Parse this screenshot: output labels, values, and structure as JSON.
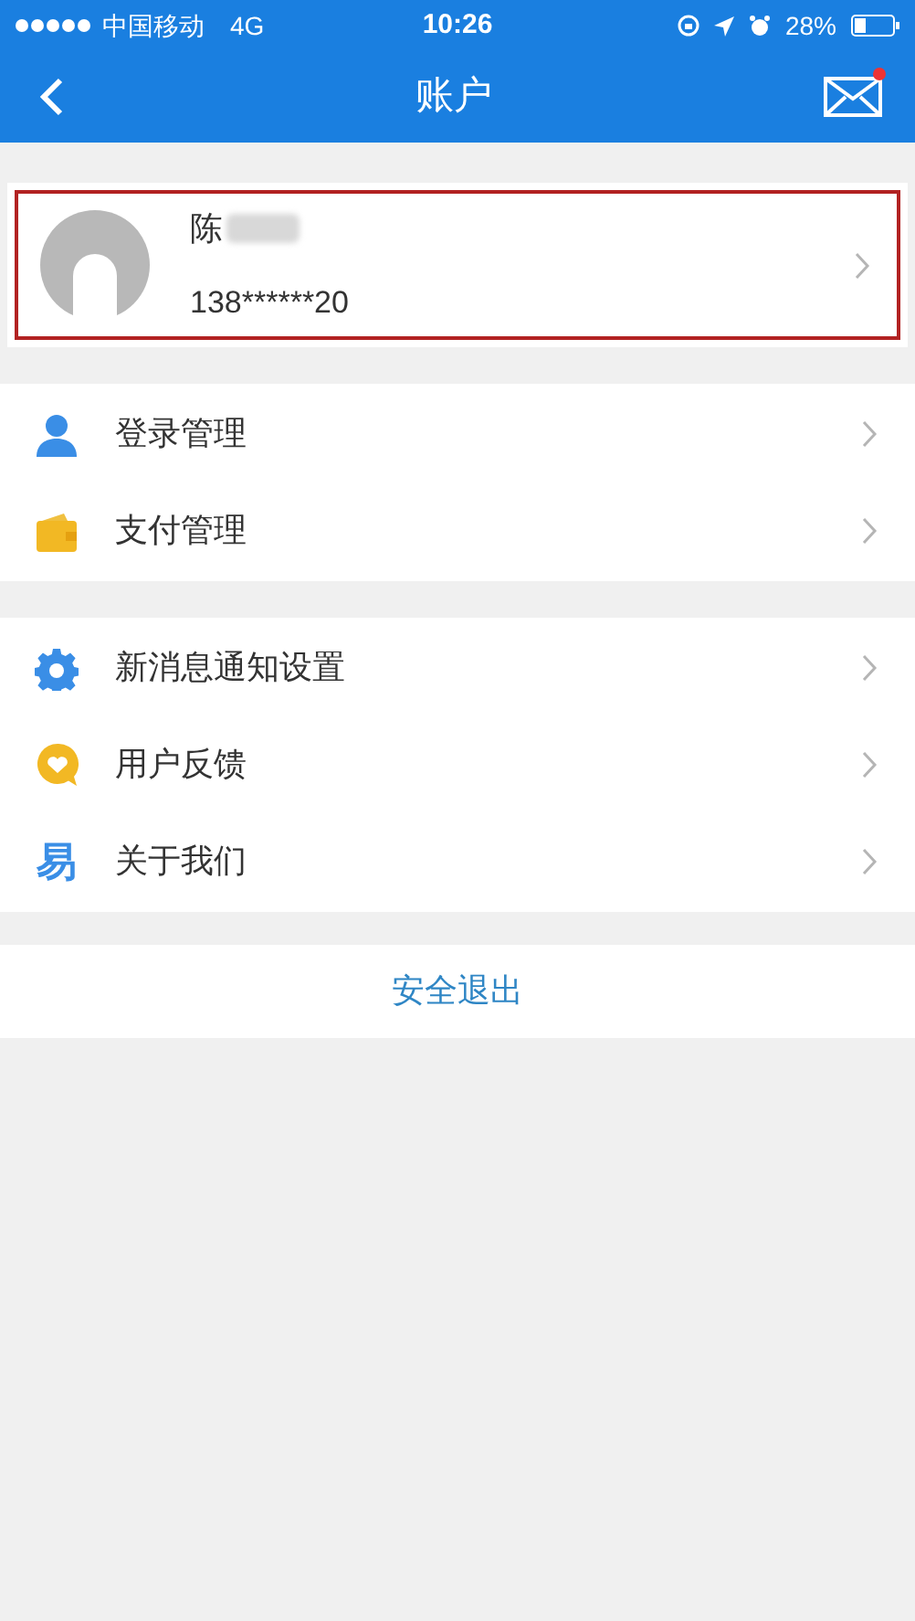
{
  "status_bar": {
    "carrier": "中国移动",
    "network": "4G",
    "time": "10:26",
    "battery": "28%"
  },
  "nav": {
    "title": "账户",
    "mail_unread": true
  },
  "profile": {
    "name": "陈",
    "name_redacted": true,
    "phone": "138******20",
    "highlighted": true
  },
  "groups": [
    {
      "items": [
        {
          "kind": "person",
          "label": "登录管理"
        },
        {
          "kind": "wallet",
          "label": "支付管理"
        }
      ]
    },
    {
      "items": [
        {
          "kind": "gear",
          "label": "新消息通知设置"
        },
        {
          "kind": "heart",
          "label": "用户反馈"
        },
        {
          "kind": "glyph",
          "glyph": "易",
          "label": "关于我们"
        }
      ]
    }
  ],
  "logout": "安全退出"
}
